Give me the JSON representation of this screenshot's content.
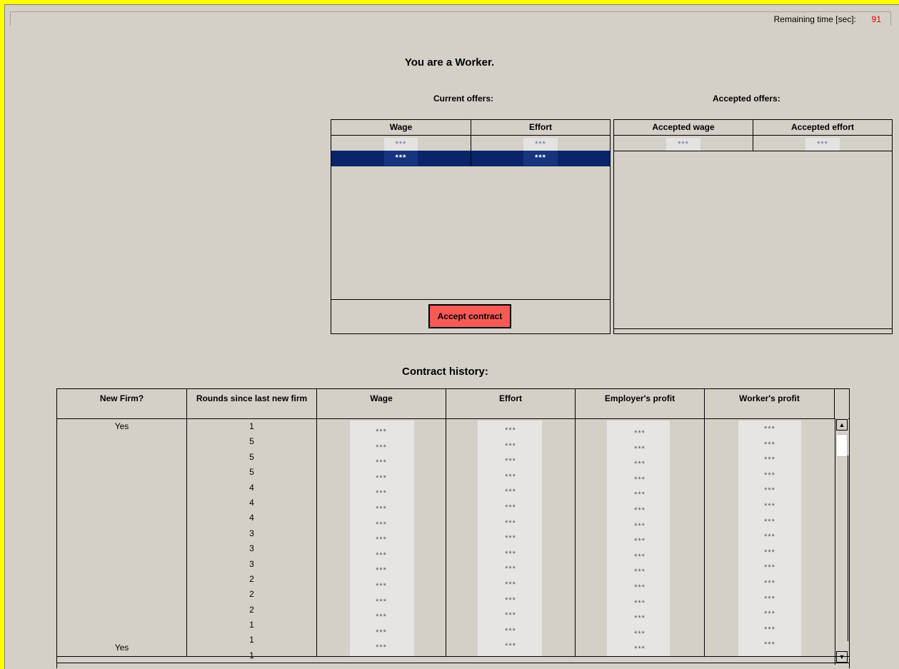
{
  "timer": {
    "label": "Remaining time [sec]:",
    "value": "91"
  },
  "title": "You are a Worker.",
  "current_offers": {
    "heading": "Current offers:",
    "columns": [
      "Wage",
      "Effort"
    ],
    "rows": [
      [
        "***",
        "***"
      ],
      [
        "***",
        "***"
      ]
    ],
    "accept_label": "Accept contract"
  },
  "accepted_offers": {
    "heading": "Accepted offers:",
    "columns": [
      "Accepted wage",
      "Accepted effort"
    ],
    "rows": [
      [
        "***",
        "***"
      ]
    ]
  },
  "history": {
    "heading": "Contract history:",
    "columns": [
      "New Firm?",
      "Rounds since last new firm",
      "Wage",
      "Effort",
      "Employer's profit",
      "Worker's profit"
    ],
    "new_firm": [
      "Yes",
      "",
      "",
      "",
      "",
      "",
      "",
      "",
      "",
      "",
      "",
      "",
      "",
      "",
      "",
      "Yes"
    ],
    "rounds": [
      "1",
      "5",
      "5",
      "5",
      "4",
      "4",
      "4",
      "3",
      "3",
      "3",
      "2",
      "2",
      "2",
      "1",
      "1",
      "1"
    ],
    "masked": "***"
  }
}
